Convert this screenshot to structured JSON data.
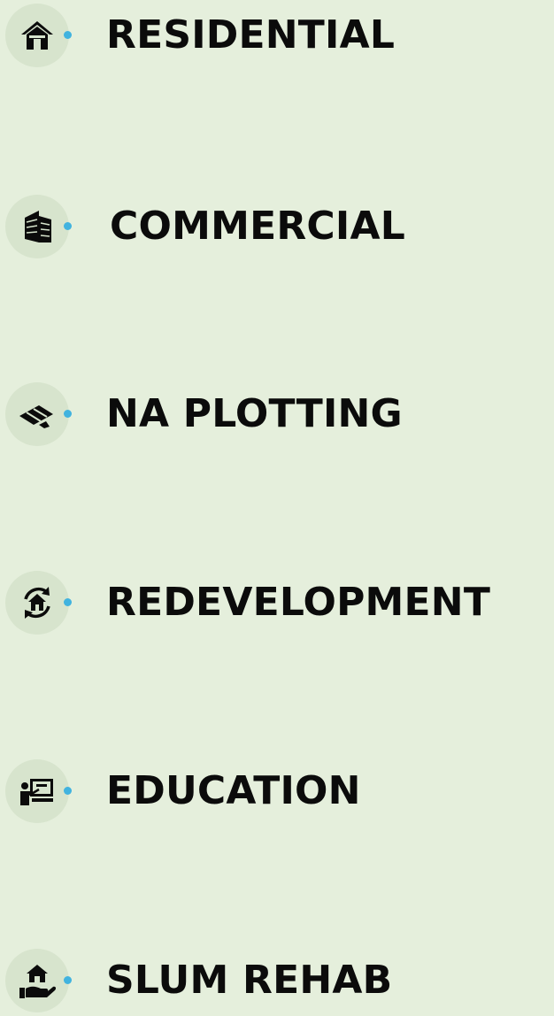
{
  "colors": {
    "background": "#e5efdc",
    "icon_circle": "#d7e4cd",
    "dot": "#41b3df",
    "text": "#0b0b0b"
  },
  "items": [
    {
      "label": "RESIDENTIAL",
      "icon": "house-icon"
    },
    {
      "label": "COMMERCIAL",
      "icon": "office-building-icon"
    },
    {
      "label": "NA PLOTTING",
      "icon": "land-plot-icon"
    },
    {
      "label": "REDEVELOPMENT",
      "icon": "house-cycle-icon"
    },
    {
      "label": "EDUCATION",
      "icon": "teacher-board-icon"
    },
    {
      "label": "SLUM REHAB",
      "icon": "hand-house-icon"
    }
  ]
}
